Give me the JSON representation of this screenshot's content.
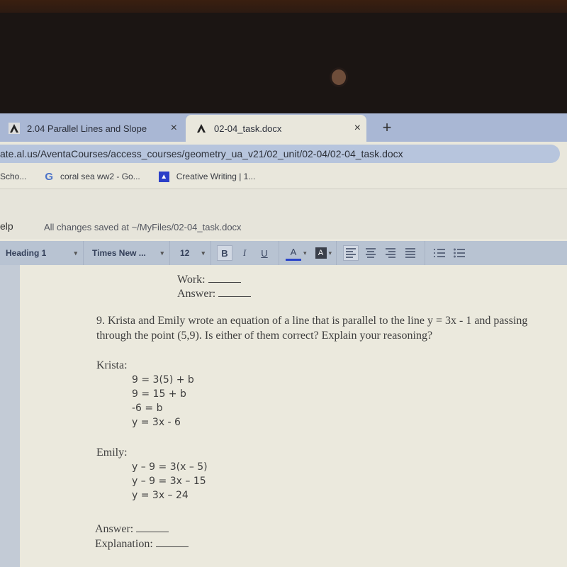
{
  "browser": {
    "tabs": [
      {
        "title": "2.04 Parallel Lines and Slope",
        "active": false
      },
      {
        "title": "02-04_task.docx",
        "active": true
      }
    ],
    "new_tab_label": "+",
    "close_label": "×",
    "url": "ate.al.us/AventaCourses/access_courses/geometry_ua_v21/02_unit/02-04/02-04_task.docx",
    "bookmarks": [
      {
        "label": "Scho...",
        "icon": "bookmark-icon"
      },
      {
        "label": "coral sea ww2 - Go...",
        "icon": "google-icon",
        "icon_glyph": "G"
      },
      {
        "label": "Creative Writing | 1...",
        "icon": "classroom-icon",
        "icon_glyph": "▲"
      }
    ]
  },
  "editor": {
    "menu_partial": "elp",
    "save_status": "All changes saved at ~/MyFiles/02-04_task.docx",
    "toolbar": {
      "style": "Heading 1",
      "font": "Times New ...",
      "size": "12",
      "bold": "B",
      "italic": "I",
      "underline": "U",
      "font_color": "A",
      "highlight": "A",
      "caret": "▾",
      "font_color_hex": "#2a44c9"
    }
  },
  "document": {
    "prev_work": "Work:",
    "prev_answer": "Answer:",
    "question_line1": "9. Krista and Emily wrote an equation of a line that is parallel to the line y = 3x - 1 and passing",
    "question_line2": "through the point (5,9).  Is either of them correct? Explain your reasoning?",
    "krista_label": "Krista:",
    "krista_steps": [
      "9 = 3(5) + b",
      "9 = 15 + b",
      "-6 = b",
      "y = 3x - 6"
    ],
    "emily_label": "Emily:",
    "emily_steps": [
      "y – 9 = 3(x – 5)",
      "y – 9 = 3x – 15",
      "y  = 3x – 24"
    ],
    "answer_label": "Answer:",
    "explanation_label": "Explanation:"
  }
}
